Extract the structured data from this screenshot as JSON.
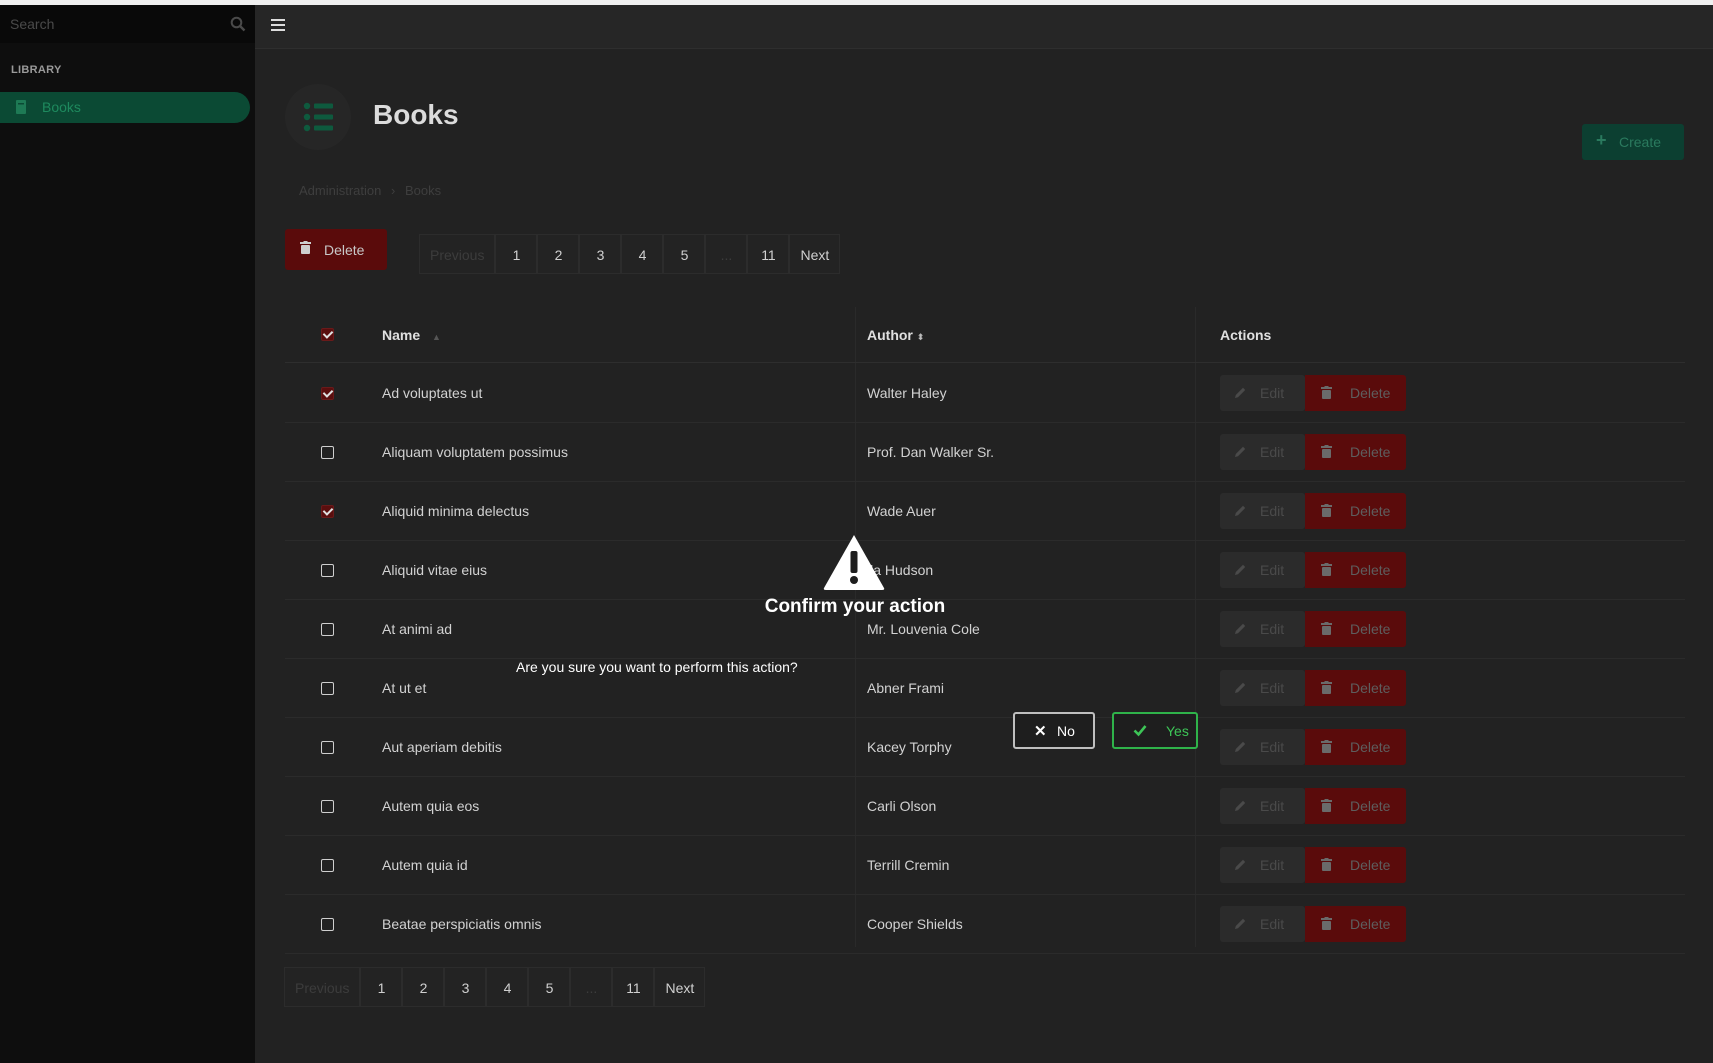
{
  "sidebar": {
    "search_placeholder": "Search",
    "section_label": "LIBRARY",
    "items": [
      {
        "label": "Books",
        "icon": "book-icon"
      }
    ]
  },
  "header": {
    "title": "Books",
    "create_label": "Create",
    "breadcrumb": [
      "Administration",
      "Books"
    ]
  },
  "toolbar": {
    "bulk_delete_label": "Delete"
  },
  "pagination": {
    "previous": "Previous",
    "pages": [
      "1",
      "2",
      "3",
      "4",
      "5",
      "...",
      "11"
    ],
    "next": "Next"
  },
  "table": {
    "columns": {
      "name": "Name",
      "author": "Author",
      "actions": "Actions"
    },
    "edit_label": "Edit",
    "delete_label": "Delete",
    "rows": [
      {
        "name": "Ad voluptates ut",
        "author": "Walter Haley",
        "checked": true
      },
      {
        "name": "Aliquam voluptatem possimus",
        "author": "Prof. Dan Walker Sr.",
        "checked": false
      },
      {
        "name": "Aliquid minima delectus",
        "author": "Wade Auer",
        "checked": true
      },
      {
        "name": "Aliquid vitae eius",
        "author": "lla Hudson",
        "checked": false
      },
      {
        "name": "At animi ad",
        "author": "Mr. Louvenia Cole",
        "checked": false
      },
      {
        "name": "At ut et",
        "author": "Abner Frami",
        "checked": false
      },
      {
        "name": "Aut aperiam debitis",
        "author": "Kacey Torphy",
        "checked": false
      },
      {
        "name": "Autem quia eos",
        "author": "Carli Olson",
        "checked": false
      },
      {
        "name": "Autem quia id",
        "author": "Terrill Cremin",
        "checked": false
      },
      {
        "name": "Beatae perspiciatis omnis",
        "author": "Cooper Shields",
        "checked": false
      }
    ]
  },
  "modal": {
    "icon": "warning-icon",
    "title": "Confirm your action",
    "message": "Are you sure you want to perform this action?",
    "no_label": "No",
    "yes_label": "Yes"
  },
  "colors": {
    "accent": "#0b4a34",
    "danger": "#5a0b0b",
    "confirm": "#2fb34a"
  }
}
